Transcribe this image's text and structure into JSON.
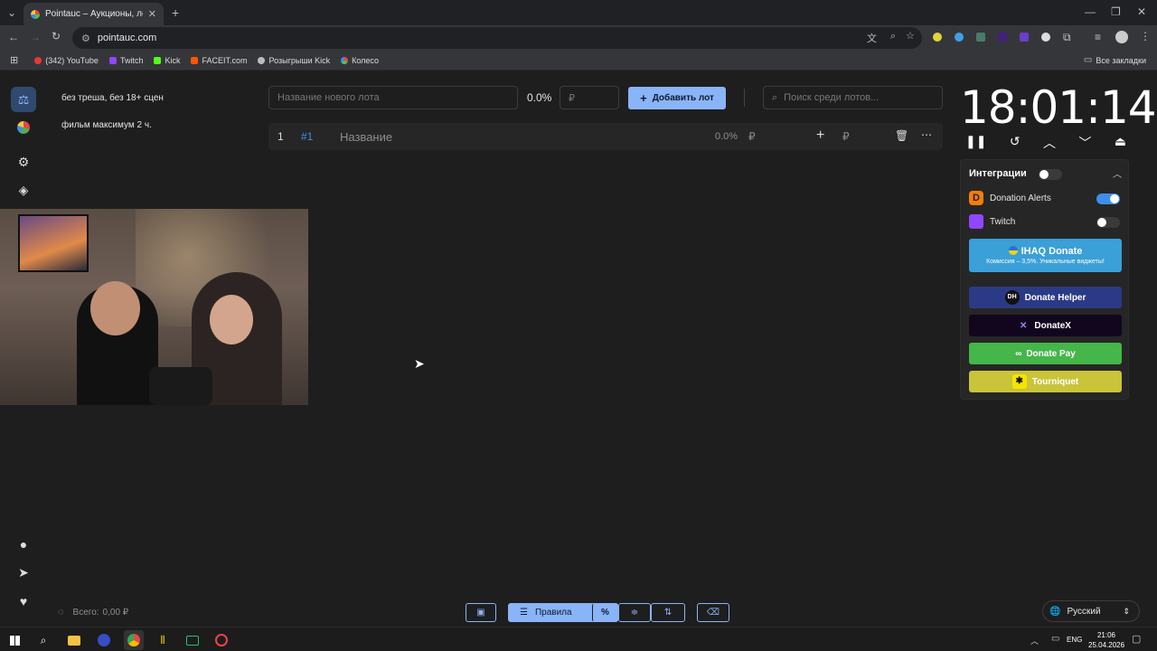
{
  "browser": {
    "tab_title": "Pointauc – Аукционы, лотереи",
    "url": "pointauc.com",
    "bookmarks": [
      {
        "label": "(342) YouTube",
        "color": "#e53935"
      },
      {
        "label": "Twitch",
        "color": "#9146ff"
      },
      {
        "label": "Kick",
        "color": "#53fc18"
      },
      {
        "label": "FACEIT.com",
        "color": "#ff5500"
      },
      {
        "label": "Розыгрыши Kick",
        "color": "#bbbbbb"
      },
      {
        "label": "Колесо",
        "color": "#fbbc04"
      }
    ],
    "all_bookmarks": "Все закладки"
  },
  "rules": {
    "line1": "без треша, без 18+ сцен",
    "line2": "фильм максимум 2 ч."
  },
  "new_lot": {
    "name_placeholder": "Название нового лота",
    "percent": "0.0%",
    "amount_placeholder": "₽",
    "add_button": "Добавить лот",
    "search_placeholder": "Поиск среди лотов..."
  },
  "lots": [
    {
      "index": "1",
      "id": "#1",
      "name": "Название",
      "percent": "0.0%",
      "currency": "₽",
      "currency2": "₽"
    }
  ],
  "timer": {
    "value": "18:01:14"
  },
  "integrations": {
    "title": "Интеграции",
    "items": [
      {
        "label": "Donation Alerts",
        "enabled": true
      },
      {
        "label": "Twitch",
        "enabled": false
      }
    ],
    "ihaq": {
      "title": "IHAQ Donate",
      "subtitle": "Комиссия – 3,5%. Уникальные виджеты!"
    },
    "promo": [
      {
        "label": "Donate Helper",
        "color": "#2b3a86"
      },
      {
        "label": "DonateX",
        "color": "#12061e"
      },
      {
        "label": "Donate Pay",
        "color": "#45b649"
      },
      {
        "label": "Tourniquet",
        "color": "#c9c43a"
      }
    ]
  },
  "footer": {
    "total_label": "Всего:",
    "total_value": "0,00 ₽",
    "rules_button": "Правила",
    "percent_symbol": "%",
    "language": "Русский"
  },
  "taskbar": {
    "lang": "ENG",
    "time": "21:06",
    "date": "25.04.2026"
  }
}
